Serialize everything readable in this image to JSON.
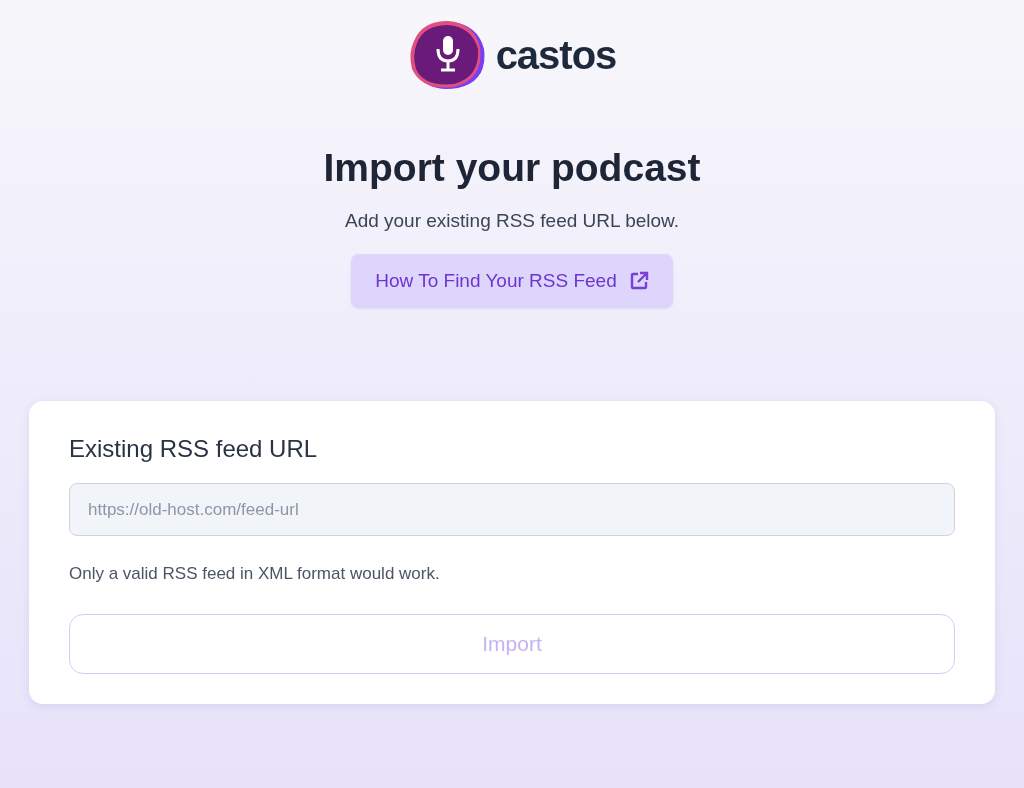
{
  "logo": {
    "wordmark": "castos"
  },
  "heading": "Import your podcast",
  "subtitle": "Add your existing RSS feed URL below.",
  "help_link": {
    "label": "How To Find Your RSS Feed"
  },
  "form": {
    "label": "Existing RSS feed URL",
    "placeholder": "https://old-host.com/feed-url",
    "hint": "Only a valid RSS feed in XML format would work.",
    "submit": {
      "label": "Import",
      "disabled": true
    }
  }
}
